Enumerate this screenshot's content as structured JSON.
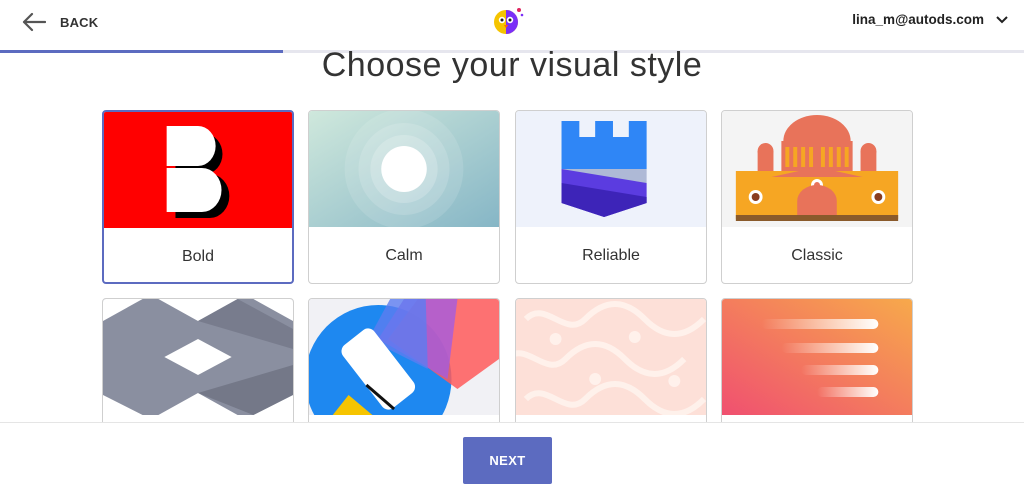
{
  "header": {
    "back_label": "BACK",
    "user_email": "lina_m@autods.com"
  },
  "progress": {
    "percent": 27.6
  },
  "page": {
    "heading": "Choose your visual style"
  },
  "styles": [
    {
      "label": "Bold",
      "selected": true
    },
    {
      "label": "Calm",
      "selected": false
    },
    {
      "label": "Reliable",
      "selected": false
    },
    {
      "label": "Classic",
      "selected": false
    },
    {
      "label": "",
      "selected": false
    },
    {
      "label": "",
      "selected": false
    },
    {
      "label": "",
      "selected": false
    },
    {
      "label": "",
      "selected": false
    }
  ],
  "footer": {
    "next_label": "NEXT"
  },
  "colors": {
    "accent": "#5c6bc0",
    "bold_red": "#ff0000",
    "reliable_blue": "#2f86f6",
    "classic_orange": "#f6a623"
  },
  "icons": {
    "back": "arrow-left-icon",
    "logo": "owl-logo-icon",
    "account_menu": "chevron-down-icon"
  }
}
